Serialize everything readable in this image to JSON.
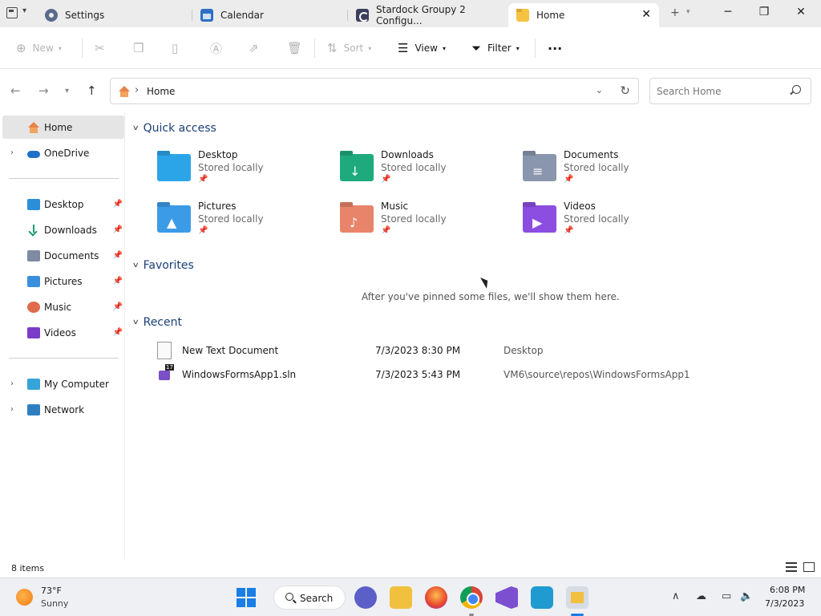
{
  "tabs": [
    {
      "label": "Settings"
    },
    {
      "label": "Calendar"
    },
    {
      "label": "Stardock Groupy 2 Configu..."
    },
    {
      "label": "Home"
    }
  ],
  "tab_close": "✕",
  "new_tab": "+",
  "window_controls": {
    "minimize": "─",
    "maximize": "❐",
    "close": "✕"
  },
  "toolbar": {
    "new_label": "New",
    "sort_label": "Sort",
    "view_label": "View",
    "filter_label": "Filter",
    "more_label": "···"
  },
  "address": {
    "crumb": "Home"
  },
  "search": {
    "placeholder": "Search Home"
  },
  "sidebar": {
    "home": "Home",
    "onedrive": "OneDrive",
    "pinned": [
      {
        "label": "Desktop"
      },
      {
        "label": "Downloads"
      },
      {
        "label": "Documents"
      },
      {
        "label": "Pictures"
      },
      {
        "label": "Music"
      },
      {
        "label": "Videos"
      }
    ],
    "my_computer": "My Computer",
    "network": "Network"
  },
  "sections": {
    "quick_access": "Quick access",
    "favorites": "Favorites",
    "recent": "Recent"
  },
  "quick_access": [
    {
      "name": "Desktop",
      "sub": "Stored locally"
    },
    {
      "name": "Downloads",
      "sub": "Stored locally"
    },
    {
      "name": "Documents",
      "sub": "Stored locally"
    },
    {
      "name": "Pictures",
      "sub": "Stored locally"
    },
    {
      "name": "Music",
      "sub": "Stored locally"
    },
    {
      "name": "Videos",
      "sub": "Stored locally"
    }
  ],
  "favorites_empty": "After you've pinned some files, we'll show them here.",
  "recent": [
    {
      "name": "New Text Document",
      "date": "7/3/2023 8:30 PM",
      "location": "Desktop"
    },
    {
      "name": "WindowsFormsApp1.sln",
      "date": "7/3/2023 5:43 PM",
      "location": "VM6\\source\\repos\\WindowsFormsApp1"
    }
  ],
  "status": {
    "count": "8 items"
  },
  "taskbar": {
    "weather_temp": "73°F",
    "weather_cond": "Sunny",
    "search_label": "Search",
    "time": "6:08 PM",
    "date": "7/3/2023"
  },
  "colors": {
    "accent": "#1a7ee6",
    "section_heading": "#1a3f78",
    "selected_nav": "#e5e5e5"
  }
}
